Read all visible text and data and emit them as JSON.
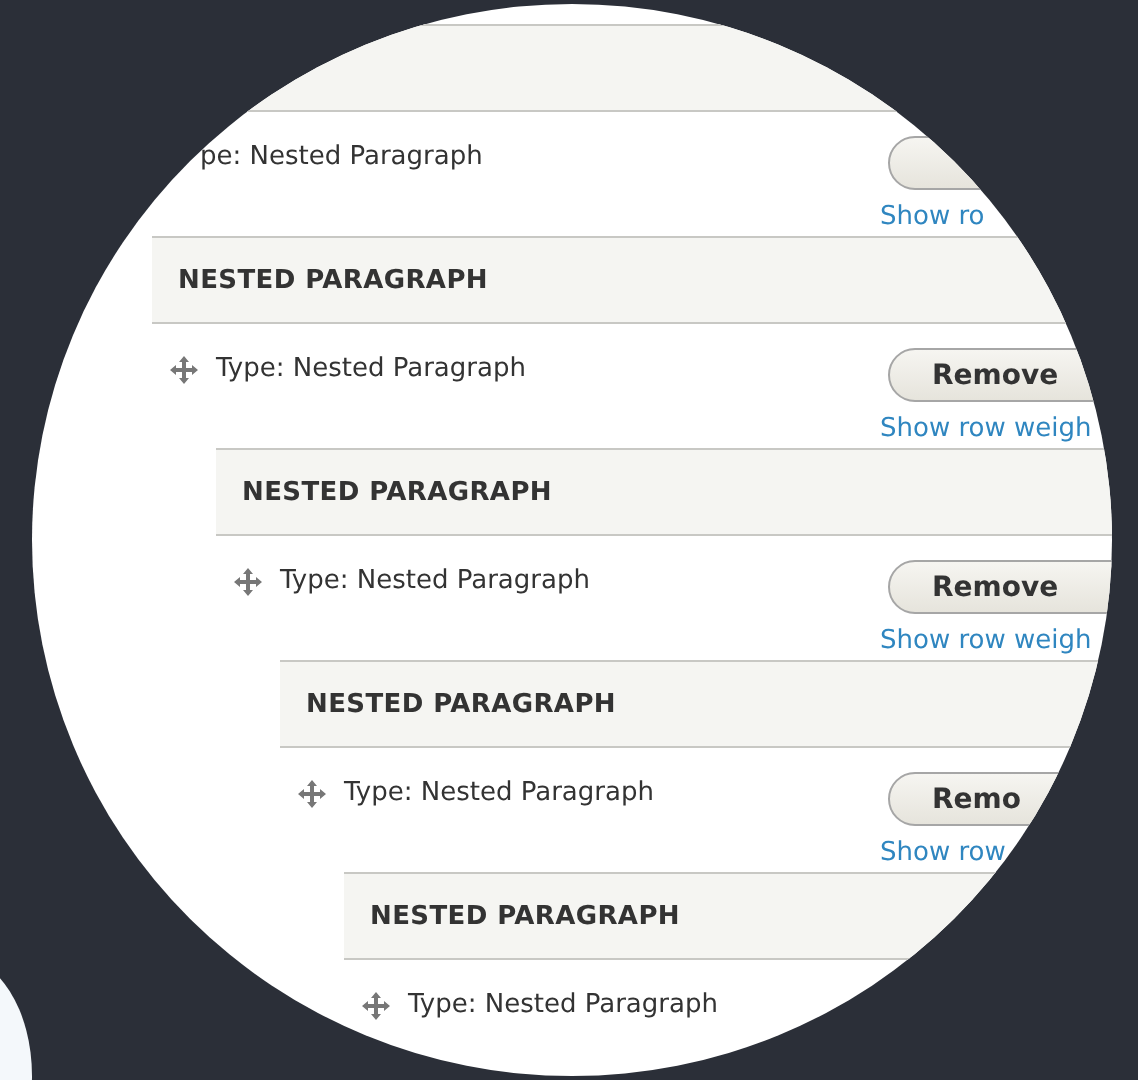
{
  "paragraphs": [
    {
      "type_label": "pe: Nested Paragraph",
      "remove_button": true,
      "link": "Show ro",
      "children": [
        {
          "heading": "NESTED PARAGRAPH",
          "type_label": "Type: Nested Paragraph",
          "remove_button": true,
          "button_label": "Remove",
          "link": "Show row weigh",
          "children": [
            {
              "heading": "NESTED PARAGRAPH",
              "type_label": "Type: Nested Paragraph",
              "remove_button": true,
              "button_label": "Remove",
              "link": "Show row weigh",
              "children": [
                {
                  "heading": "NESTED PARAGRAPH",
                  "type_label": "Type: Nested Paragraph",
                  "remove_button": true,
                  "button_label": "Remo",
                  "link": "Show row",
                  "children": [
                    {
                      "heading": "NESTED PARAGRAPH",
                      "type_label": "Type: Nested Paragraph",
                      "remove_button": false
                    }
                  ]
                }
              ]
            }
          ]
        }
      ]
    }
  ]
}
